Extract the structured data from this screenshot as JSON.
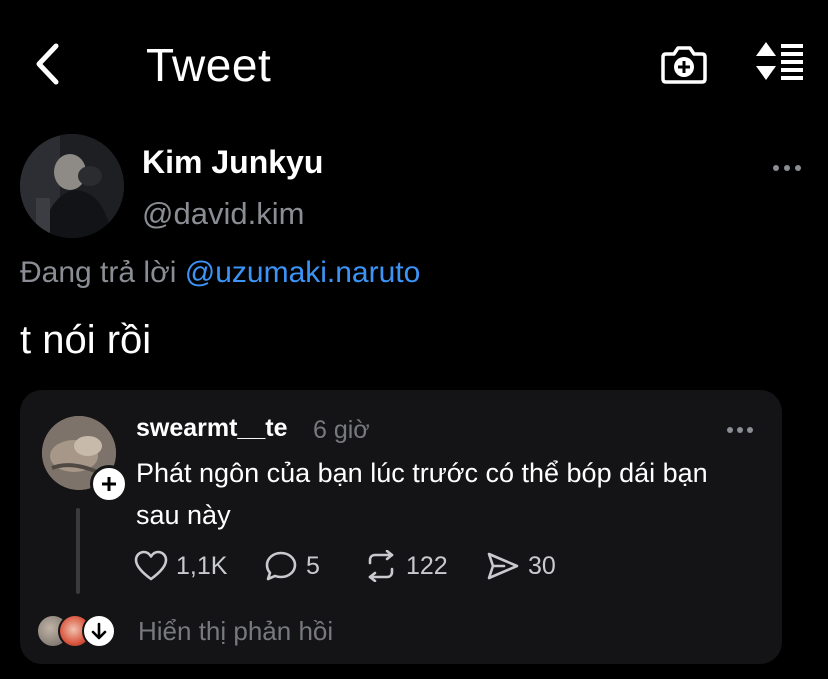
{
  "header": {
    "title": "Tweet"
  },
  "tweet": {
    "author_name": "Kim Junkyu",
    "author_handle": "@david.kim",
    "reply_prefix": "Đang trả lời",
    "reply_mention": "@uzumaki.naruto",
    "text": "t nói rồi"
  },
  "quoted": {
    "username": "swearmt__te",
    "time": "6 giờ",
    "text": "Phát ngôn của bạn lúc trước có thể bóp dái bạn sau này",
    "likes": "1,1K",
    "comments": "5",
    "reposts": "122",
    "shares": "30",
    "show_replies": "Hiển thị phản hồi"
  },
  "colors": {
    "background": "#000000",
    "card": "#141416",
    "mention": "#3b94f6",
    "muted": "#8a8d93"
  },
  "icons": [
    "chevron-left-icon",
    "camera-plus-icon",
    "sort-icon",
    "more-icon",
    "heart-icon",
    "comment-icon",
    "repost-icon",
    "share-icon",
    "plus-icon",
    "arrow-down-icon"
  ]
}
